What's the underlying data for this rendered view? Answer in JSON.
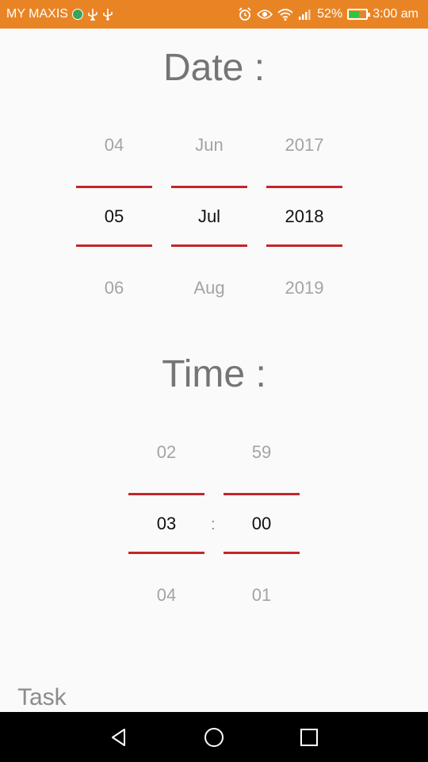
{
  "status_bar": {
    "carrier": "MY MAXIS",
    "battery_percent": "52%",
    "battery_level": 0.52,
    "time": "3:00 am",
    "icons": [
      "globe-icon",
      "usb-icon",
      "usb-icon",
      "alarm-icon",
      "eye-icon",
      "wifi-icon",
      "signal-icon",
      "battery-charging-icon"
    ],
    "background": "#e98424"
  },
  "date_section": {
    "title": "Date :",
    "day": {
      "prev": "04",
      "selected": "05",
      "next": "06"
    },
    "month": {
      "prev": "Jun",
      "selected": "Jul",
      "next": "Aug"
    },
    "year": {
      "prev": "2017",
      "selected": "2018",
      "next": "2019"
    }
  },
  "time_section": {
    "title": "Time :",
    "hour": {
      "prev": "02",
      "selected": "03",
      "next": "04"
    },
    "separator": ":",
    "minute": {
      "prev": "59",
      "selected": "00",
      "next": "01"
    }
  },
  "task": {
    "label": "Task"
  },
  "nav_bar": {
    "buttons": [
      "back-icon",
      "home-icon",
      "recents-icon"
    ]
  },
  "colors": {
    "accent_line": "#c3262b",
    "heading": "#757575"
  }
}
